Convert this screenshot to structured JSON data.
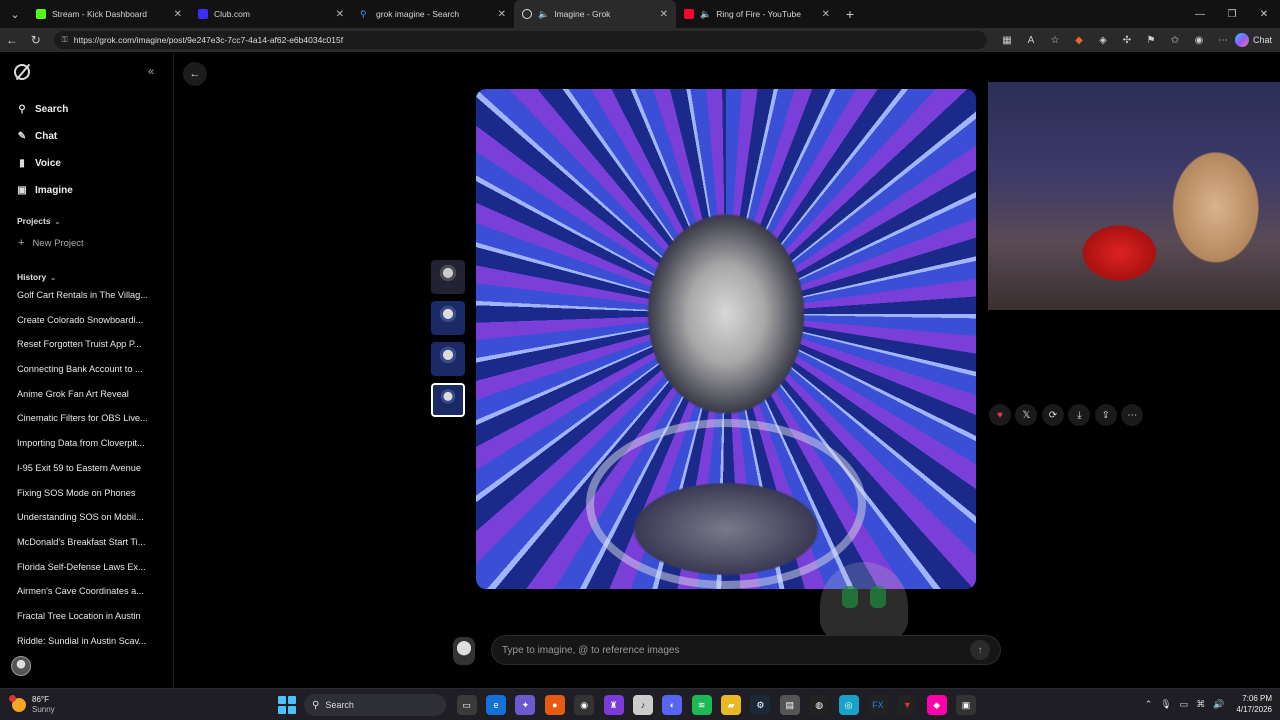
{
  "browser": {
    "tabs": [
      {
        "title": "Stream - Kick Dashboard",
        "color": "#53fc18",
        "active": false
      },
      {
        "title": "Club.com",
        "color": "#3b2cff",
        "active": false
      },
      {
        "title": "grok imagine - Search",
        "color": "#1b74e8",
        "active": false
      },
      {
        "title": "Imagine - Grok",
        "color": "#dddddd",
        "active": true
      },
      {
        "title": "Ring of Fire - YouTube",
        "color": "#ff0033",
        "active": false
      }
    ],
    "url": "https://grok.com/imagine/post/9e247e3c-7cc7-4a14-af62-e6b4034c015f",
    "copilot_label": "Chat"
  },
  "sidebar": {
    "nav": [
      {
        "label": "Search",
        "icon": "search-icon"
      },
      {
        "label": "Chat",
        "icon": "chat-icon"
      },
      {
        "label": "Voice",
        "icon": "voice-icon"
      },
      {
        "label": "Imagine",
        "icon": "image-icon"
      }
    ],
    "projects_label": "Projects",
    "new_project_label": "New Project",
    "history_label": "History",
    "history": [
      "Golf Cart Rentals in The Villag...",
      "Create Colorado Snowboardi...",
      "Reset Forgotten Truist App P...",
      "Connecting Bank Account to ...",
      "Anime Grok Fan Art Reveal",
      "Cinematic Filters for OBS Live...",
      "Importing Data from Cloverpit...",
      "I-95 Exit 59 to Eastern Avenue",
      "Fixing SOS Mode on Phones",
      "Understanding SOS on Mobil...",
      "McDonald's Breakfast Start Ti...",
      "Florida Self-Defense Laws Ex...",
      "Airmen's Cave Coordinates a...",
      "Fractal Tree Location in Austin",
      "Riddle: Sundial in Austin Scav..."
    ]
  },
  "main": {
    "prompt_placeholder": "Type to imagine, @ to reference images",
    "actions": [
      "heart-icon",
      "x-share-icon",
      "regenerate-icon",
      "download-icon",
      "share-icon",
      "more-icon"
    ]
  },
  "taskbar": {
    "temp": "86°F",
    "condition": "Sunny",
    "search_label": "Search",
    "time": "7:06 PM",
    "date": "4/17/2026"
  }
}
